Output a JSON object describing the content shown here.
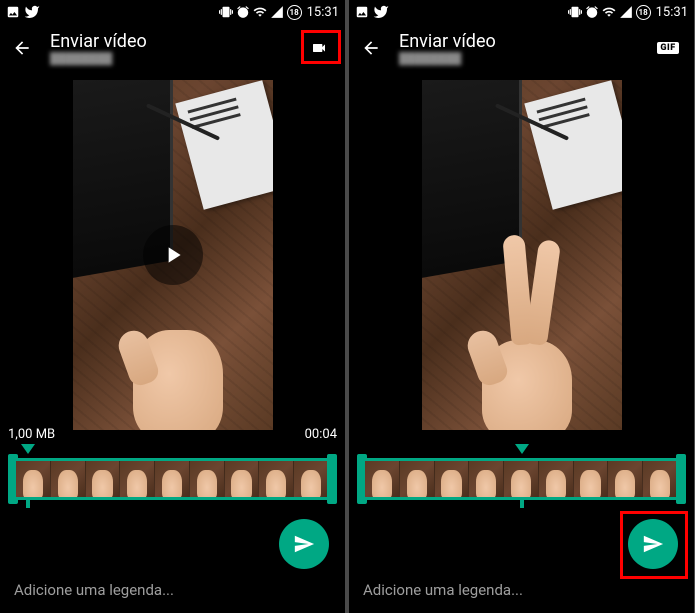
{
  "status": {
    "time": "15:31",
    "battery_level": "18"
  },
  "app": {
    "title": "Enviar vídeo",
    "contact_name": "████████"
  },
  "left_screen": {
    "mode": "video",
    "file_size": "1,00 MB",
    "duration": "00:04",
    "trim_marker_pct": 6
  },
  "right_screen": {
    "mode": "gif",
    "mode_label": "GIF",
    "trim_marker_pct": 50
  },
  "caption_placeholder": "Adicione uma legenda...",
  "colors": {
    "accent": "#00a884",
    "highlight": "#ff0000"
  },
  "frames_count": 9
}
